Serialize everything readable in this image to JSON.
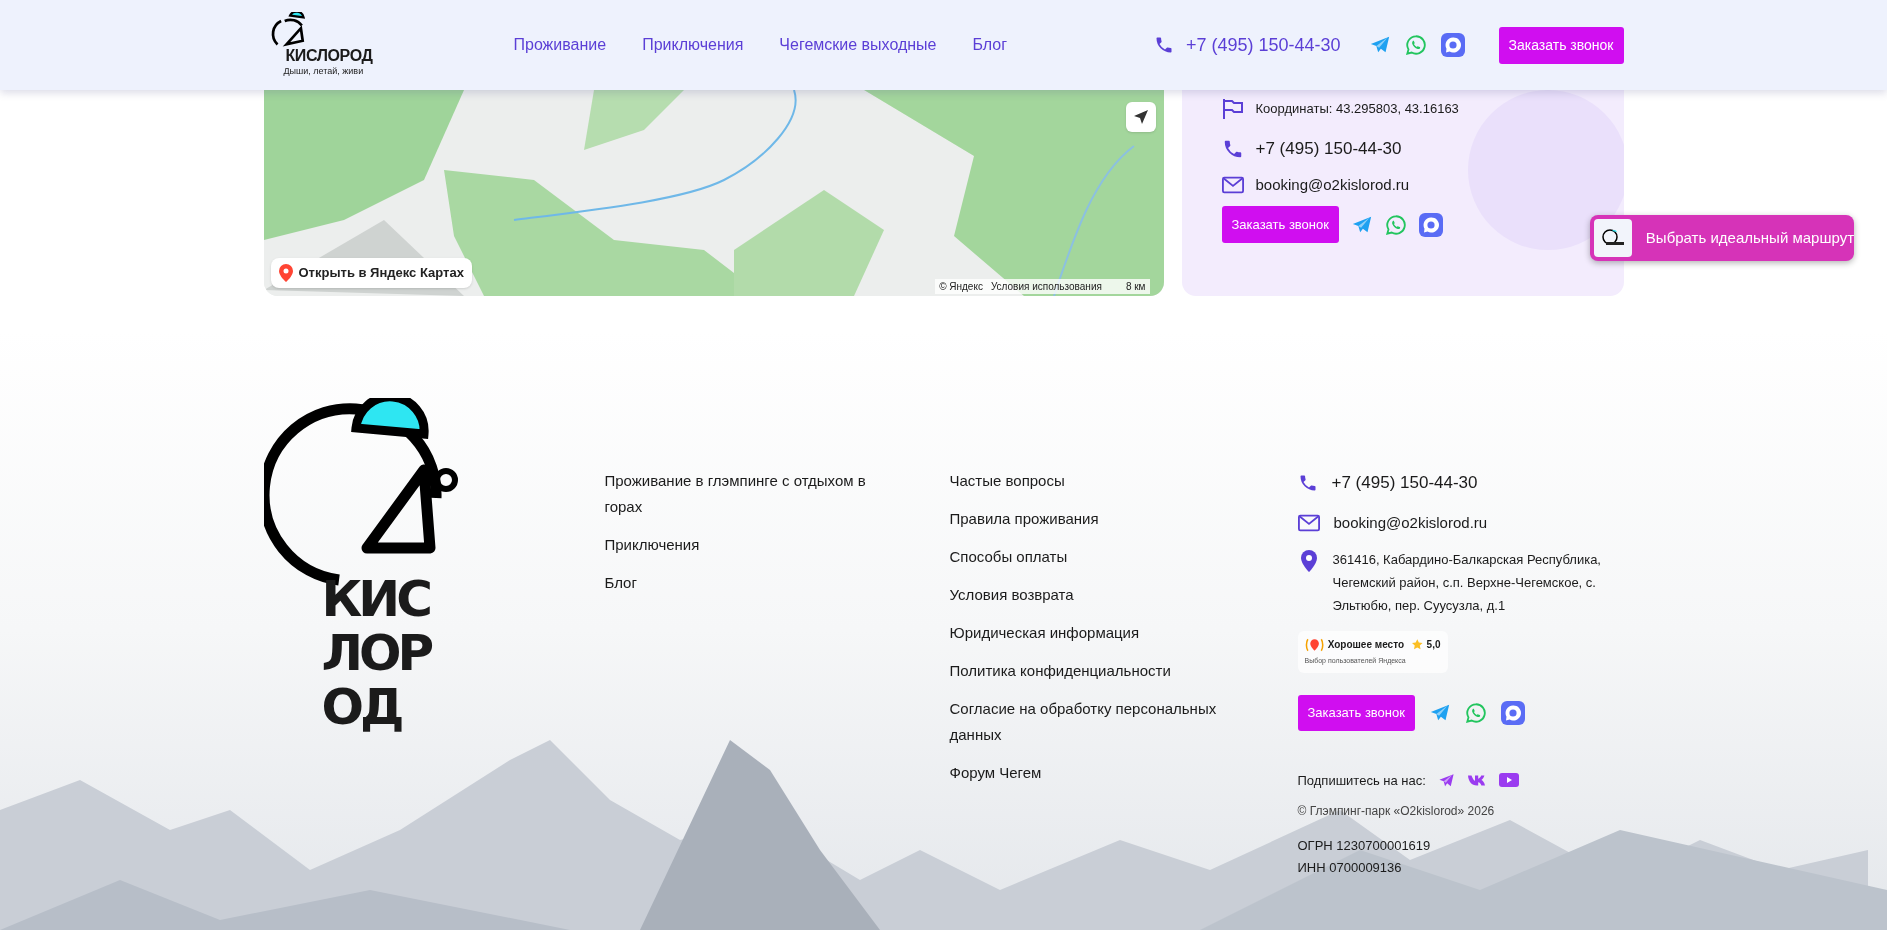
{
  "header": {
    "logo": {
      "wordmark": "КИСЛОРОД",
      "tagline": "Дыши, летай, живи"
    },
    "nav": [
      "Проживание",
      "Приключения",
      "Чегемские выходные",
      "Блог"
    ],
    "phone": "+7 (495) 150-44-30",
    "call_button": "Заказать звонок"
  },
  "map": {
    "open_link": "Открыть в Яндекс Картах",
    "copyright": "© Яндекс",
    "terms": "Условия использования",
    "scale": "8 км"
  },
  "contact_card": {
    "coordinates": "Координаты: 43.295803, 43.16163",
    "phone": "+7 (495) 150-44-30",
    "email": "booking@o2kislorod.ru",
    "call_button": "Заказать звонок"
  },
  "route_button": "Выбрать идеальный маршрут",
  "footer": {
    "logo_lines": [
      "КИС",
      "ЛОР",
      "ОД"
    ],
    "links_1": [
      "Проживание в глэмпинге с отдыхом в горах",
      "Приключения",
      "Блог"
    ],
    "links_2": [
      "Частые вопросы",
      "Правила проживания",
      "Способы оплаты",
      "Условия возврата",
      "Юридическая информация",
      "Политика конфиденциальности",
      "Согласие на обработку персональных данных",
      "Форум Чегем"
    ],
    "phone": "+7 (495) 150-44-30",
    "email": "booking@o2kislorod.ru",
    "address": "361416, Кабардино-Балкарская Республика, Чегемский район, с.п. Верхне-Чегемское, с. Эльтюбю, пер. Суусузла, д.1",
    "badge": {
      "title": "Хорошее место",
      "rating": "5,0",
      "caption": "Выбор пользователей Яндекса"
    },
    "call_button": "Заказать звонок",
    "subscribe_label": "Подпишитесь на нас:",
    "copyright": "© Глэмпинг-парк «O2kislorod» 2026",
    "ogrn": "ОГРН 1230700001619",
    "inn": "ИНН 0700009136"
  }
}
